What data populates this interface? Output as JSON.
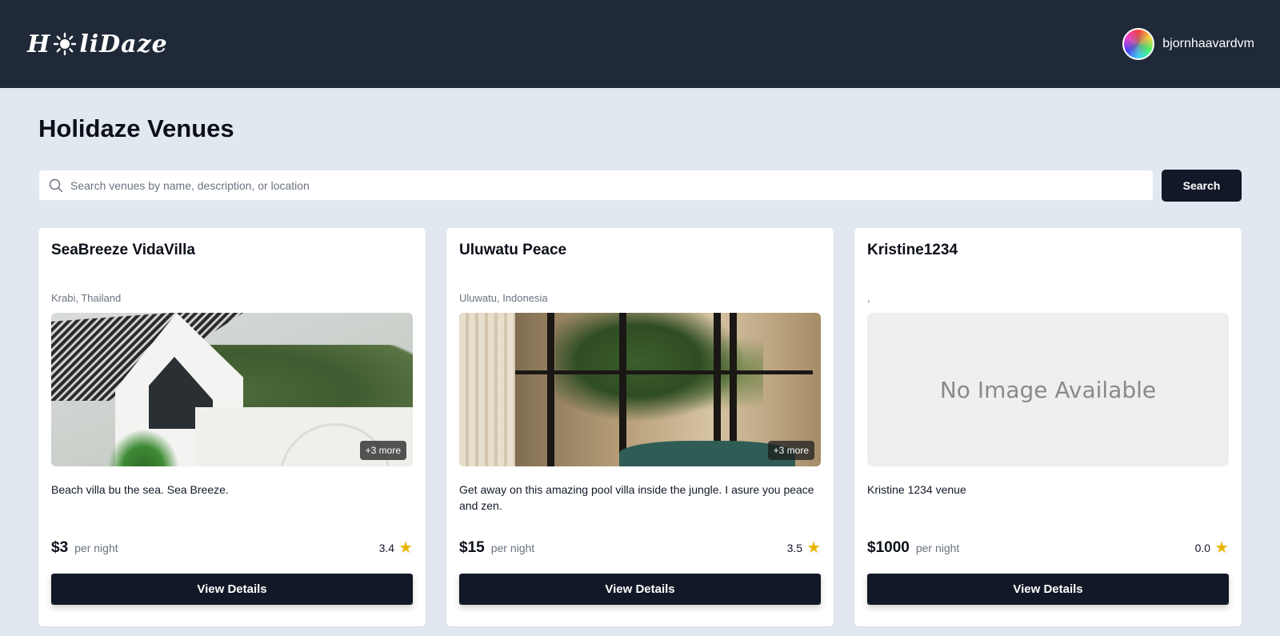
{
  "header": {
    "logo_text_left": "H",
    "logo_text_right": "liDaze",
    "username": "bjornhaavardvm"
  },
  "main": {
    "title": "Holidaze Venues",
    "search": {
      "placeholder": "Search venues by name, description, or location",
      "value": "",
      "button_label": "Search"
    }
  },
  "venues": [
    {
      "name": "SeaBreeze VidaVilla",
      "location": "Krabi, Thailand",
      "more_images": "+3 more",
      "description": "Beach villa bu the sea. Sea Breeze.",
      "price": "$3",
      "price_unit": "per night",
      "rating": "3.4",
      "button_label": "View Details"
    },
    {
      "name": "Uluwatu Peace",
      "location": "Uluwatu, Indonesia",
      "more_images": "+3 more",
      "description": "Get away on this amazing pool villa inside the jungle. I asure you peace and zen.",
      "price": "$15",
      "price_unit": "per night",
      "rating": "3.5",
      "button_label": "View Details"
    },
    {
      "name": "Kristine1234",
      "location": ",",
      "no_image_text": "No Image Available",
      "description": "Kristine 1234 venue",
      "price": "$1000",
      "price_unit": "per night",
      "rating": "0.0",
      "button_label": "View Details"
    }
  ],
  "colors": {
    "header_bg": "#1f2937",
    "page_bg": "#e2e8f0",
    "button_bg": "#111827",
    "star": "#eab308"
  },
  "icons": {
    "search": "search-icon",
    "star": "star-icon",
    "logo_sun": "sun-icon"
  }
}
